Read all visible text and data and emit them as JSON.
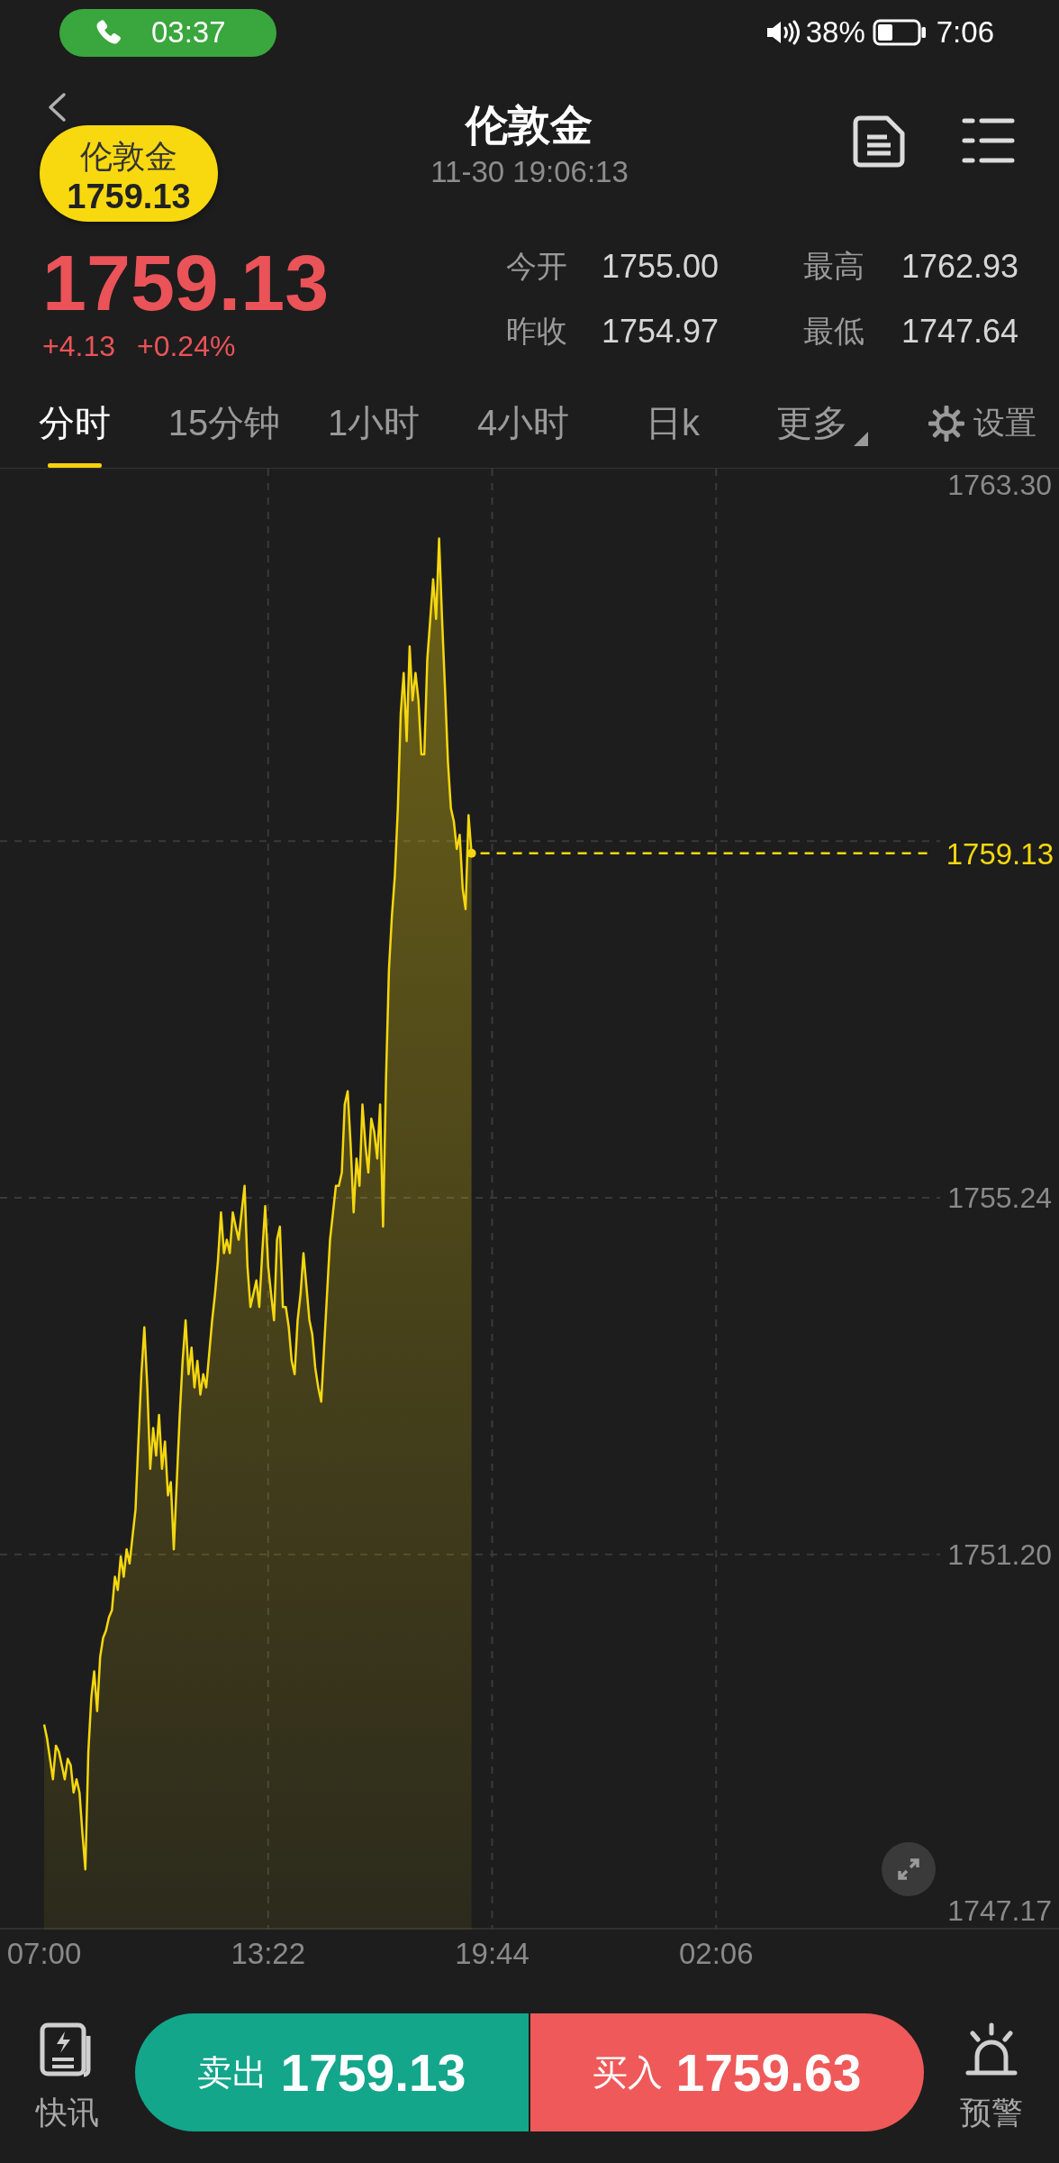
{
  "status_bar": {
    "call_time": "03:37",
    "battery": "38%",
    "time": "7:06"
  },
  "header": {
    "title": "伦敦金",
    "timestamp": "11-30 19:06:13"
  },
  "floating_widget": {
    "name": "伦敦金",
    "price": "1759.13"
  },
  "quote": {
    "price": "1759.13",
    "change": "+4.13",
    "change_percent": "+0.24%",
    "stats": [
      {
        "label": "今开",
        "value": "1755.00"
      },
      {
        "label": "最高",
        "value": "1762.93"
      },
      {
        "label": "昨收",
        "value": "1754.97"
      },
      {
        "label": "最低",
        "value": "1747.64"
      }
    ]
  },
  "tabs": [
    {
      "label": "分时",
      "selected": true,
      "kind": "period"
    },
    {
      "label": "15分钟",
      "selected": false,
      "kind": "period"
    },
    {
      "label": "1小时",
      "selected": false,
      "kind": "period"
    },
    {
      "label": "4小时",
      "selected": false,
      "kind": "period"
    },
    {
      "label": "日k",
      "selected": false,
      "kind": "period"
    },
    {
      "label": "更多",
      "selected": false,
      "kind": "dropdown"
    }
  ],
  "settings": {
    "label": "设置"
  },
  "chart": {
    "chart_data": {
      "type": "area",
      "categories": [
        "07:00",
        null,
        null,
        null,
        null,
        null,
        null,
        null,
        null,
        null,
        null,
        null,
        null,
        null,
        null,
        null,
        null,
        null,
        null,
        null,
        null,
        null,
        null,
        null,
        null,
        null,
        null,
        null,
        null,
        null,
        null,
        null,
        null,
        null,
        null,
        null,
        null,
        null,
        null,
        null,
        null,
        null,
        null,
        null,
        null,
        null,
        null,
        null,
        null,
        null,
        null,
        null,
        null,
        null,
        null,
        null,
        null,
        null,
        null,
        null,
        null,
        null,
        null,
        null,
        null,
        null,
        null,
        null,
        null,
        null,
        null,
        null,
        null,
        null,
        null,
        null,
        "13:22",
        null,
        null,
        null,
        null,
        null,
        null,
        null,
        null,
        null,
        null,
        null,
        null,
        null,
        null,
        null,
        null,
        null,
        null,
        null,
        null,
        null,
        null,
        null,
        null,
        null,
        null,
        null,
        null,
        null,
        null,
        null,
        null,
        null,
        null,
        null,
        null,
        null,
        null,
        null,
        null,
        null,
        null,
        null,
        null,
        null,
        null,
        null,
        null,
        null,
        null,
        null,
        null,
        null,
        null,
        null,
        null,
        null,
        null,
        null,
        null,
        null,
        null,
        null,
        null,
        null,
        null,
        null,
        null,
        null,
        null,
        null,
        null,
        null,
        null,
        null,
        "19:44",
        null,
        null,
        null,
        null,
        null,
        null,
        null,
        null,
        null,
        null,
        null,
        null,
        null,
        null,
        null,
        null,
        null,
        null,
        null,
        null,
        null,
        null,
        null,
        null,
        null,
        null,
        null,
        null,
        null,
        null,
        null,
        null,
        null,
        null,
        null,
        null,
        null,
        null,
        null,
        null,
        null,
        null,
        null,
        null,
        null,
        null,
        null,
        null,
        null,
        null,
        null,
        null,
        null,
        null,
        null,
        null,
        null,
        null,
        null,
        null,
        null,
        null,
        null,
        null,
        null,
        null,
        null,
        null,
        null,
        null,
        null,
        null,
        null,
        null,
        null,
        "02:06",
        null,
        null,
        null,
        null,
        null,
        null,
        null,
        null,
        null,
        null,
        null,
        null,
        null,
        null,
        null,
        null,
        null,
        null,
        null,
        null,
        null,
        null,
        null,
        null,
        null,
        null,
        null,
        null,
        null,
        null,
        null,
        null,
        null,
        null,
        null,
        null,
        null,
        null,
        null,
        null,
        null,
        null,
        null,
        null,
        null,
        null,
        null,
        null,
        null,
        null,
        null,
        null,
        null,
        null,
        null,
        null,
        null,
        null,
        null,
        null,
        null,
        null,
        null,
        null,
        null,
        null,
        null,
        null,
        null,
        null,
        null,
        null,
        null,
        null,
        null,
        null
      ],
      "values": [
        1749.28,
        1749.12,
        1748.89,
        1748.66,
        1749.04,
        1748.97,
        1748.82,
        1748.66,
        1748.89,
        1748.82,
        1748.51,
        1748.66,
        1748.51,
        1748.05,
        1747.64,
        1748.97,
        1749.58,
        1749.88,
        1749.43,
        1750.04,
        1750.26,
        1750.34,
        1750.49,
        1750.57,
        1750.95,
        1750.8,
        1751.18,
        1750.95,
        1751.26,
        1751.1,
        1751.41,
        1751.71,
        1752.48,
        1753.24,
        1753.77,
        1753.09,
        1752.17,
        1752.63,
        1752.32,
        1752.78,
        1752.17,
        1752.48,
        1751.87,
        1752.02,
        1751.26,
        1752.02,
        1752.78,
        1753.39,
        1753.85,
        1753.24,
        1753.54,
        1753.09,
        1753.39,
        1753.01,
        1753.24,
        1753.09,
        1753.47,
        1753.85,
        1754.15,
        1754.53,
        1755.07,
        1754.61,
        1754.76,
        1754.61,
        1755.07,
        1754.91,
        1754.76,
        1755.07,
        1755.37,
        1754.46,
        1754.0,
        1754.15,
        1754.3,
        1754.0,
        1754.61,
        1755.14,
        1754.46,
        1754.15,
        1753.85,
        1754.76,
        1754.91,
        1754.0,
        1754.0,
        1753.77,
        1753.39,
        1753.24,
        1753.85,
        1754.15,
        1754.61,
        1754.23,
        1753.85,
        1753.69,
        1753.31,
        1753.09,
        1752.93,
        1753.54,
        1754.15,
        1754.76,
        1755.07,
        1755.37,
        1755.37,
        1755.52,
        1756.29,
        1756.44,
        1755.83,
        1755.07,
        1755.68,
        1755.37,
        1756.29,
        1755.83,
        1755.52,
        1756.13,
        1755.98,
        1755.68,
        1756.29,
        1754.91,
        1756.59,
        1757.81,
        1758.42,
        1758.88,
        1759.64,
        1760.71,
        1761.17,
        1760.4,
        1761.47,
        1760.86,
        1761.17,
        1760.86,
        1760.25,
        1760.25,
        1761.32,
        1761.78,
        1762.23,
        1761.78,
        1762.69,
        1761.78,
        1761.01,
        1760.17,
        1759.64,
        1759.49,
        1759.18,
        1759.34,
        1758.73,
        1758.5,
        1759.56,
        1759.13,
        null,
        null,
        null,
        null,
        null,
        null,
        null,
        null,
        null,
        null,
        null,
        null,
        null,
        null,
        null,
        null,
        null,
        null,
        null,
        null,
        null,
        null,
        null,
        null,
        null,
        null,
        null,
        null,
        null,
        null,
        null,
        null,
        null,
        null,
        null,
        null,
        null,
        null,
        null,
        null,
        null,
        null,
        null,
        null,
        null,
        null,
        null,
        null,
        null,
        null,
        null,
        null,
        null,
        null,
        null,
        null,
        null,
        null,
        null,
        null,
        null,
        null,
        null,
        null,
        null,
        null,
        null,
        null,
        null,
        null,
        null,
        null,
        null,
        null,
        null,
        null,
        null,
        null,
        null,
        null,
        null,
        null,
        null,
        null,
        null,
        null,
        null,
        null,
        null,
        null,
        null,
        null,
        null,
        null,
        null,
        null,
        null,
        null,
        null,
        null,
        null,
        null,
        null,
        null,
        null,
        null,
        null,
        null,
        null,
        null,
        null,
        null,
        null,
        null,
        null,
        null,
        null,
        null,
        null,
        null,
        null,
        null,
        null,
        null,
        null,
        null,
        null,
        null,
        null,
        null,
        null,
        null,
        null,
        null,
        null,
        null,
        null,
        null,
        null,
        null,
        null,
        null,
        null,
        null,
        null,
        null,
        null,
        null,
        null,
        null,
        null,
        null,
        null,
        null,
        null,
        null,
        null,
        null,
        null
      ],
      "ylim": [
        1746.96,
        1763.48
      ],
      "yticks": [
        {
          "value": 1747.17,
          "label": "1747.17"
        },
        {
          "value": 1751.2,
          "label": "1751.20"
        },
        {
          "value": 1755.24,
          "label": "1755.24"
        },
        {
          "value": 1763.3,
          "label": "1763.30"
        }
      ]
    },
    "current_price": "1759.13"
  },
  "bottom_bar": {
    "news": {
      "label": "快讯"
    },
    "sell": {
      "label": "卖出",
      "price": "1759.13"
    },
    "buy": {
      "label": "买入",
      "price": "1759.63"
    },
    "alert": {
      "label": "预警"
    }
  }
}
